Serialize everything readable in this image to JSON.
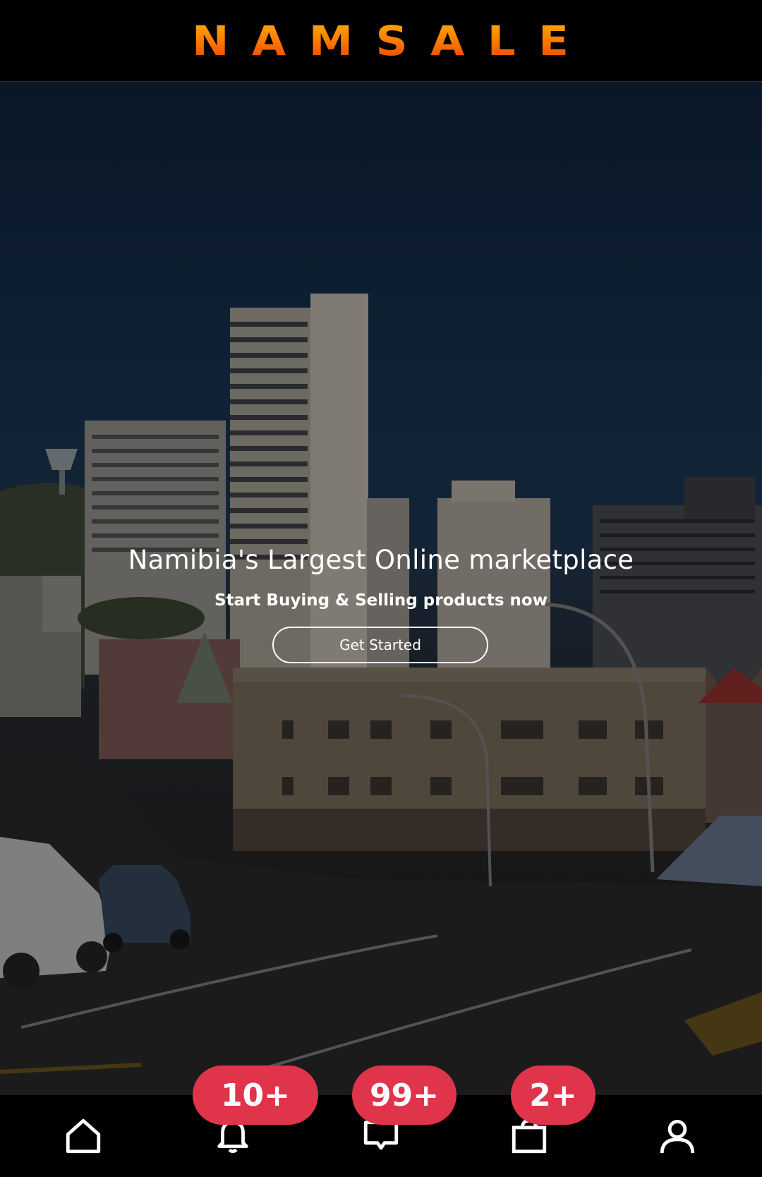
{
  "header": {
    "logo_text": "NAMSALE",
    "logo_colors": {
      "top": "#ffb300",
      "middle": "#ff7a00",
      "bottom": "#e23b00"
    }
  },
  "hero": {
    "title": "Namibia's Largest Online marketplace",
    "subtitle": "Start Buying & Selling products now",
    "cta_label": "Get Started"
  },
  "bottom_nav": {
    "items": [
      {
        "icon": "home-icon"
      },
      {
        "icon": "bell-icon",
        "badge": "10+"
      },
      {
        "icon": "chat-icon",
        "badge": "99+"
      },
      {
        "icon": "shopping-bag-icon",
        "badge": "2+"
      },
      {
        "icon": "profile-icon"
      }
    ],
    "badge_color": "#e0344b"
  }
}
